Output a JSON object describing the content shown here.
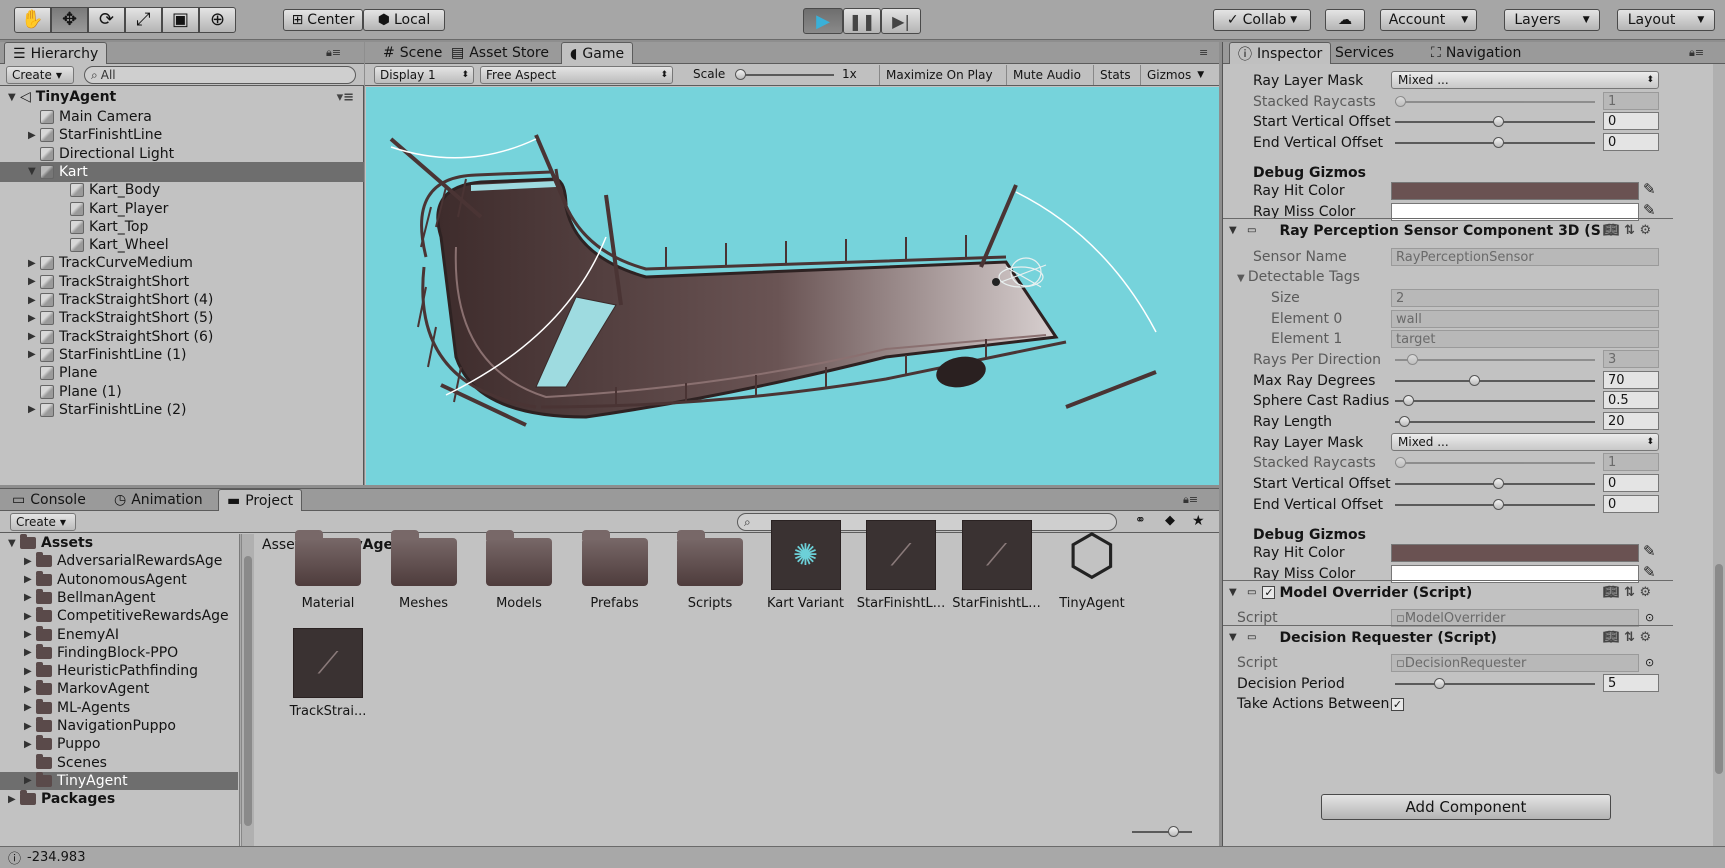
{
  "toolbar": {
    "center": "Center",
    "local": "Local",
    "collab": "Collab",
    "account": "Account",
    "layers": "Layers",
    "layout": "Layout"
  },
  "hierarchy": {
    "tab": "Hierarchy",
    "create": "Create",
    "search_placeholder": "All",
    "scene": "TinyAgent",
    "items": [
      {
        "label": "Main Camera",
        "expand": false
      },
      {
        "label": "StarFinishtLine",
        "expand": true
      },
      {
        "label": "Directional Light",
        "expand": false
      },
      {
        "label": "Kart",
        "expand": true
      },
      {
        "label": "Kart_Body"
      },
      {
        "label": "Kart_Player"
      },
      {
        "label": "Kart_Top"
      },
      {
        "label": "Kart_Wheel"
      },
      {
        "label": "TrackCurveMedium",
        "expand": true
      },
      {
        "label": "TrackStraightShort",
        "expand": true
      },
      {
        "label": "TrackStraightShort (4)",
        "expand": true
      },
      {
        "label": "TrackStraightShort (5)",
        "expand": true
      },
      {
        "label": "TrackStraightShort (6)",
        "expand": true
      },
      {
        "label": "StarFinishtLine (1)",
        "expand": true
      },
      {
        "label": "Plane"
      },
      {
        "label": "Plane (1)"
      },
      {
        "label": "StarFinishtLine (2)",
        "expand": true
      }
    ]
  },
  "game": {
    "tabs": [
      "Scene",
      "Asset Store",
      "Game"
    ],
    "display": "Display 1",
    "aspect": "Free Aspect",
    "scale_label": "Scale",
    "scale_value": "1x",
    "maximize": "Maximize On Play",
    "mute": "Mute Audio",
    "stats": "Stats",
    "gizmos": "Gizmos",
    "bg": "#76d3db"
  },
  "bottom": {
    "tabs": [
      "Console",
      "Animation",
      "Project"
    ],
    "create": "Create"
  },
  "project": {
    "tree": [
      "Assets",
      "AdversarialRewardsAge",
      "AutonomousAgent",
      "BellmanAgent",
      "CompetitiveRewardsAge",
      "EnemyAI",
      "FindingBlock-PPO",
      "HeuristicPathfinding",
      "MarkovAgent",
      "ML-Agents",
      "NavigationPuppo",
      "Puppo",
      "Scenes",
      "TinyAgent",
      "Packages"
    ],
    "breadcrumb": [
      "Assets",
      "TinyAgent"
    ],
    "assets": [
      "Material",
      "Meshes",
      "Models",
      "Prefabs",
      "Scripts",
      "Kart Variant",
      "StarFinishtL...",
      "StarFinishtL...",
      "TinyAgent",
      "TrackStrai..."
    ]
  },
  "status": {
    "text": "-234.983"
  },
  "inspector": {
    "tabs": [
      "Inspector",
      "Services",
      "Navigation"
    ],
    "top": {
      "ray_layer_mask": "Ray Layer Mask",
      "mixed": "Mixed ...",
      "stacked": "Stacked Raycasts",
      "stacked_v": "1",
      "start_off": "Start Vertical Offset",
      "start_v": "0",
      "end_off": "End Vertical Offset",
      "end_v": "0",
      "debug": "Debug Gizmos",
      "hit": "Ray Hit Color",
      "miss": "Ray Miss Color"
    },
    "ray": {
      "title": "Ray Perception Sensor Component 3D (S",
      "sensor_name": "Sensor Name",
      "sensor_val": "RayPerceptionSensor",
      "tags": "Detectable Tags",
      "size": "Size",
      "size_v": "2",
      "el0": "Element 0",
      "el0_v": "wall",
      "el1": "Element 1",
      "el1_v": "target",
      "rpd": "Rays Per Direction",
      "rpd_v": "3",
      "mrd": "Max Ray Degrees",
      "mrd_v": "70",
      "scr": "Sphere Cast Radius",
      "scr_v": "0.5",
      "rl": "Ray Length",
      "rl_v": "20",
      "rlm": "Ray Layer Mask",
      "rlm_v": "Mixed ...",
      "sr": "Stacked Raycasts",
      "sr_v": "1",
      "svo": "Start Vertical Offset",
      "svo_v": "0",
      "evo": "End Vertical Offset",
      "evo_v": "0",
      "debug": "Debug Gizmos",
      "hit": "Ray Hit Color",
      "miss": "Ray Miss Color"
    },
    "model": {
      "title": "Model Overrider (Script)",
      "script": "Script",
      "script_v": "ModelOverrider"
    },
    "decision": {
      "title": "Decision Requester (Script)",
      "script": "Script",
      "script_v": "DecisionRequester",
      "period": "Decision Period",
      "period_v": "5",
      "take": "Take Actions Between"
    },
    "add_component": "Add Component",
    "hit_color": "#6a5252",
    "miss_color": "#ffffff"
  }
}
